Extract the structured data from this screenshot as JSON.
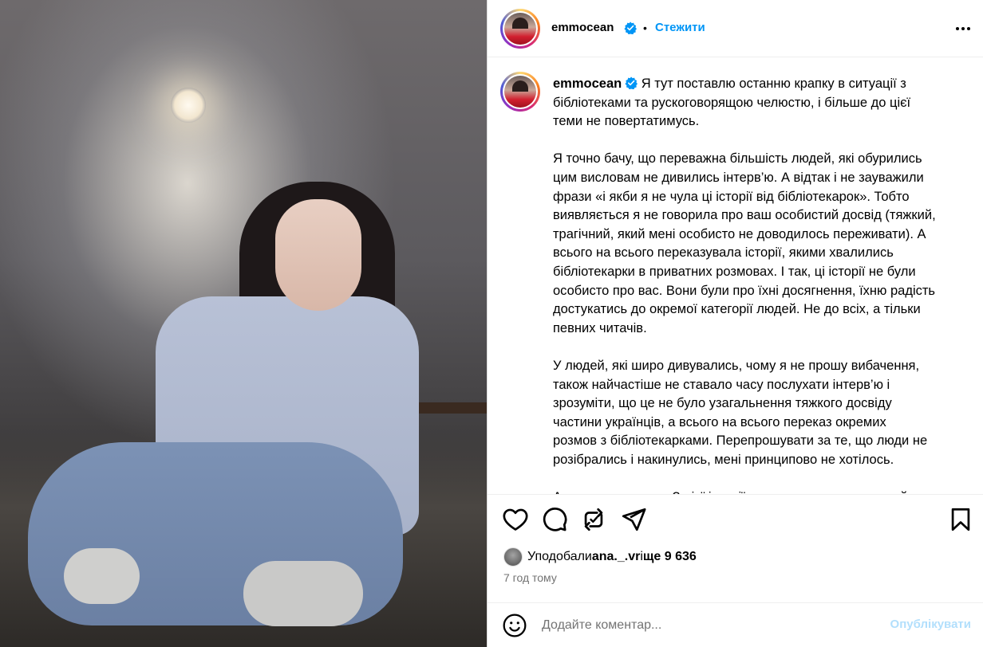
{
  "post": {
    "username": "emmocean",
    "dot": "•",
    "follow_label": "Стежити",
    "caption_username": "emmocean",
    "caption": " Я тут поставлю останню крапку в ситуації з\nбібліотеками та рускоговорящою челюстю, і більше до цієї\nтеми не повертатимусь.\n\nЯ точно бачу, що переважна більшість людей, які обурились\nцим висловам не дивились інтерв’ю. А відтак і не зауважили\nфрази «і якби я не чула ці історії від бібліотекарок». Тобто\nвиявляється я не говорила про ваш особистий досвід (тяжкий,\nтрагічний, який мені особисто не доводилось переживати). А\nвсього на всього переказувала історії, якими хвалились\nбібліотекарки в приватних розмовах. І так, ці історії не були\nособисто про вас. Вони були про їхні досягнення, їхню радість\nдостукатись до окремої категорії людей. Не до всіх, а тільки\nпевних читачів.\n\nУ людей, які широ дивувались, чому я не прошу вибачення,\nтакож найчастіше не ставало часу послухати інтерв’ю і\nзрозуміти, що це не було узагальнення тяжкого досвіду\nчастини українців, а всього на всього переказ окремих\nрозмов з бібліотекарками. Перепрошувати за те, що люди не\nрозібрались і накинулись, мені принципово не хотілось.\n\nАле мушу визнати. З цієї історії я винесла дуже важливий\nурок. Годі вже цих любеснот. Ніяких вам ні-ні-ні, ні"
  },
  "likes": {
    "prefix": "Уподобали ",
    "user": "ana._.vr",
    "middle": " і ",
    "count": "ще 9 636"
  },
  "timestamp": "7 год тому",
  "comment": {
    "placeholder": "Додайте коментар...",
    "post_label": "Опублікувати"
  },
  "colors": {
    "accent": "#0095f6",
    "verified": "#0095f6",
    "post_disabled": "#b2dffc",
    "muted": "#737373"
  },
  "icons": [
    "more-options-icon",
    "verified-badge-icon",
    "heart-icon",
    "comment-icon",
    "repost-icon",
    "share-icon",
    "bookmark-icon",
    "emoji-icon"
  ]
}
